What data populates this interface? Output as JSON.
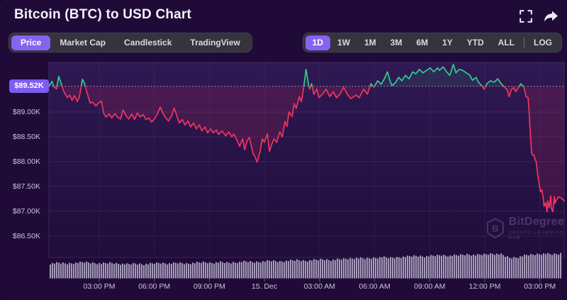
{
  "header": {
    "title": "Bitcoin (BTC) to USD Chart",
    "fullscreen_icon": "fullscreen",
    "share_icon": "share-arrow"
  },
  "toolbar": {
    "tabs": [
      {
        "label": "Price",
        "active": true
      },
      {
        "label": "Market Cap",
        "active": false
      },
      {
        "label": "Candlestick",
        "active": false
      },
      {
        "label": "TradingView",
        "active": false
      }
    ],
    "ranges": [
      {
        "label": "1D",
        "active": true
      },
      {
        "label": "1W",
        "active": false
      },
      {
        "label": "1M",
        "active": false
      },
      {
        "label": "3M",
        "active": false
      },
      {
        "label": "6M",
        "active": false
      },
      {
        "label": "1Y",
        "active": false
      },
      {
        "label": "YTD",
        "active": false
      },
      {
        "label": "ALL",
        "active": false
      }
    ],
    "log_label": "LOG"
  },
  "watermark": {
    "name": "BitDegree",
    "tagline": "CRYPTO LEARNING HUB"
  },
  "colors": {
    "background": "#200b38",
    "accent": "#8663f3",
    "badge": "#7c5cf3",
    "line_up": "#31cd8e",
    "line_down": "#f1355f",
    "volume_bar": "#b7aecb",
    "axis_text": "#c9c2da"
  },
  "chart_data": {
    "type": "line",
    "title": "Bitcoin (BTC) to USD, 1D",
    "current_price_label": "$89.52K",
    "baseline_price": 89.52,
    "ylim": [
      86.07,
      90.0
    ],
    "y_ticks": [
      {
        "price": 89.0,
        "label": "$89.00K"
      },
      {
        "price": 88.5,
        "label": "$88.50K"
      },
      {
        "price": 88.0,
        "label": "$88.00K"
      },
      {
        "price": 87.5,
        "label": "$87.50K"
      },
      {
        "price": 87.0,
        "label": "$87.00K"
      },
      {
        "price": 86.5,
        "label": "$86.50K"
      }
    ],
    "x_ticks": [
      "03:00 PM",
      "06:00 PM",
      "09:00 PM",
      "15. Dec",
      "03:00 AM",
      "06:00 AM",
      "09:00 AM",
      "12:00 PM",
      "03:00 PM"
    ],
    "legend_position": "none",
    "grid": true,
    "points": [
      [
        0,
        89.53
      ],
      [
        0.004,
        89.58
      ],
      [
        0.006,
        89.62
      ],
      [
        0.01,
        89.5
      ],
      [
        0.015,
        89.47
      ],
      [
        0.019,
        89.72
      ],
      [
        0.023,
        89.6
      ],
      [
        0.025,
        89.53
      ],
      [
        0.03,
        89.39
      ],
      [
        0.036,
        89.29
      ],
      [
        0.04,
        89.34
      ],
      [
        0.045,
        89.24
      ],
      [
        0.05,
        89.33
      ],
      [
        0.055,
        89.21
      ],
      [
        0.059,
        89.3
      ],
      [
        0.065,
        89.66
      ],
      [
        0.069,
        89.58
      ],
      [
        0.074,
        89.39
      ],
      [
        0.08,
        89.18
      ],
      [
        0.085,
        89.2
      ],
      [
        0.091,
        89.12
      ],
      [
        0.096,
        89.18
      ],
      [
        0.102,
        89.22
      ],
      [
        0.106,
        88.98
      ],
      [
        0.111,
        88.9
      ],
      [
        0.117,
        88.96
      ],
      [
        0.122,
        88.88
      ],
      [
        0.128,
        88.97
      ],
      [
        0.133,
        88.9
      ],
      [
        0.139,
        88.86
      ],
      [
        0.144,
        89.04
      ],
      [
        0.15,
        88.92
      ],
      [
        0.155,
        88.86
      ],
      [
        0.161,
        88.96
      ],
      [
        0.166,
        88.85
      ],
      [
        0.172,
        88.98
      ],
      [
        0.177,
        88.9
      ],
      [
        0.183,
        88.95
      ],
      [
        0.188,
        88.85
      ],
      [
        0.194,
        88.88
      ],
      [
        0.199,
        88.8
      ],
      [
        0.205,
        88.86
      ],
      [
        0.21,
        88.95
      ],
      [
        0.216,
        89.1
      ],
      [
        0.221,
        88.98
      ],
      [
        0.227,
        88.88
      ],
      [
        0.232,
        88.82
      ],
      [
        0.238,
        88.92
      ],
      [
        0.243,
        89.08
      ],
      [
        0.249,
        88.9
      ],
      [
        0.253,
        88.78
      ],
      [
        0.259,
        88.85
      ],
      [
        0.264,
        88.74
      ],
      [
        0.27,
        88.82
      ],
      [
        0.275,
        88.7
      ],
      [
        0.281,
        88.78
      ],
      [
        0.286,
        88.66
      ],
      [
        0.292,
        88.74
      ],
      [
        0.297,
        88.62
      ],
      [
        0.303,
        88.7
      ],
      [
        0.308,
        88.58
      ],
      [
        0.314,
        88.66
      ],
      [
        0.319,
        88.58
      ],
      [
        0.325,
        88.64
      ],
      [
        0.329,
        88.55
      ],
      [
        0.336,
        88.62
      ],
      [
        0.343,
        88.52
      ],
      [
        0.349,
        88.6
      ],
      [
        0.355,
        88.5
      ],
      [
        0.359,
        88.56
      ],
      [
        0.366,
        88.41
      ],
      [
        0.37,
        88.31
      ],
      [
        0.376,
        88.46
      ],
      [
        0.38,
        88.24
      ],
      [
        0.384,
        88.41
      ],
      [
        0.389,
        88.49
      ],
      [
        0.393,
        88.31
      ],
      [
        0.396,
        88.17
      ],
      [
        0.4,
        88.1
      ],
      [
        0.404,
        87.99
      ],
      [
        0.41,
        88.21
      ],
      [
        0.414,
        88.46
      ],
      [
        0.418,
        88.39
      ],
      [
        0.424,
        88.56
      ],
      [
        0.428,
        88.21
      ],
      [
        0.432,
        88.34
      ],
      [
        0.437,
        88.46
      ],
      [
        0.442,
        88.39
      ],
      [
        0.448,
        88.6
      ],
      [
        0.453,
        88.5
      ],
      [
        0.458,
        88.81
      ],
      [
        0.462,
        88.71
      ],
      [
        0.466,
        89.0
      ],
      [
        0.472,
        88.91
      ],
      [
        0.476,
        89.17
      ],
      [
        0.48,
        89.07
      ],
      [
        0.486,
        89.31
      ],
      [
        0.49,
        89.21
      ],
      [
        0.494,
        89.46
      ],
      [
        0.499,
        89.86
      ],
      [
        0.503,
        89.6
      ],
      [
        0.506,
        89.46
      ],
      [
        0.51,
        89.57
      ],
      [
        0.514,
        89.36
      ],
      [
        0.52,
        89.46
      ],
      [
        0.524,
        89.29
      ],
      [
        0.531,
        89.36
      ],
      [
        0.538,
        89.46
      ],
      [
        0.545,
        89.31
      ],
      [
        0.552,
        89.41
      ],
      [
        0.558,
        89.29
      ],
      [
        0.565,
        89.36
      ],
      [
        0.572,
        89.5
      ],
      [
        0.579,
        89.36
      ],
      [
        0.586,
        89.27
      ],
      [
        0.596,
        89.34
      ],
      [
        0.602,
        89.29
      ],
      [
        0.611,
        89.46
      ],
      [
        0.618,
        89.36
      ],
      [
        0.625,
        89.57
      ],
      [
        0.631,
        89.5
      ],
      [
        0.638,
        89.63
      ],
      [
        0.645,
        89.56
      ],
      [
        0.651,
        89.67
      ],
      [
        0.657,
        89.81
      ],
      [
        0.662,
        89.63
      ],
      [
        0.666,
        89.53
      ],
      [
        0.673,
        89.6
      ],
      [
        0.679,
        89.7
      ],
      [
        0.685,
        89.63
      ],
      [
        0.692,
        89.74
      ],
      [
        0.699,
        89.67
      ],
      [
        0.706,
        89.81
      ],
      [
        0.712,
        89.77
      ],
      [
        0.719,
        89.86
      ],
      [
        0.726,
        89.79
      ],
      [
        0.733,
        89.84
      ],
      [
        0.74,
        89.89
      ],
      [
        0.747,
        89.81
      ],
      [
        0.754,
        89.89
      ],
      [
        0.758,
        89.84
      ],
      [
        0.765,
        89.91
      ],
      [
        0.772,
        89.81
      ],
      [
        0.778,
        89.74
      ],
      [
        0.785,
        89.96
      ],
      [
        0.79,
        89.79
      ],
      [
        0.796,
        89.86
      ],
      [
        0.803,
        89.84
      ],
      [
        0.81,
        89.79
      ],
      [
        0.817,
        89.74
      ],
      [
        0.822,
        89.64
      ],
      [
        0.829,
        89.7
      ],
      [
        0.834,
        89.6
      ],
      [
        0.84,
        89.53
      ],
      [
        0.845,
        89.46
      ],
      [
        0.85,
        89.57
      ],
      [
        0.857,
        89.63
      ],
      [
        0.864,
        89.6
      ],
      [
        0.871,
        89.67
      ],
      [
        0.878,
        89.57
      ],
      [
        0.884,
        89.5
      ],
      [
        0.889,
        89.46
      ],
      [
        0.893,
        89.31
      ],
      [
        0.898,
        89.46
      ],
      [
        0.902,
        89.49
      ],
      [
        0.906,
        89.41
      ],
      [
        0.912,
        89.5
      ],
      [
        0.916,
        89.57
      ],
      [
        0.92,
        89.53
      ],
      [
        0.923,
        89.46
      ],
      [
        0.926,
        89.31
      ],
      [
        0.93,
        89.29
      ],
      [
        0.932,
        88.99
      ],
      [
        0.934,
        88.6
      ],
      [
        0.937,
        88.17
      ],
      [
        0.939,
        88.13
      ],
      [
        0.941,
        88.14
      ],
      [
        0.944,
        88.03
      ],
      [
        0.946,
        87.99
      ],
      [
        0.948,
        87.79
      ],
      [
        0.95,
        87.64
      ],
      [
        0.953,
        87.46
      ],
      [
        0.954,
        87.39
      ],
      [
        0.957,
        87.43
      ],
      [
        0.96,
        87.21
      ],
      [
        0.961,
        87.1
      ],
      [
        0.964,
        87.17
      ],
      [
        0.967,
        86.99
      ],
      [
        0.968,
        87.21
      ],
      [
        0.971,
        87.07
      ],
      [
        0.974,
        87.31
      ],
      [
        0.975,
        87.06
      ],
      [
        0.978,
        86.99
      ],
      [
        0.981,
        87.3
      ],
      [
        0.982,
        87.16
      ],
      [
        0.985,
        87.23
      ],
      [
        0.989,
        87.29
      ],
      [
        0.994,
        87.27
      ],
      [
        1,
        87.21
      ]
    ],
    "volume_profile": [
      21,
      22,
      21,
      22,
      23,
      22,
      21,
      22,
      21,
      20,
      21,
      20,
      21,
      22,
      21,
      22,
      21,
      22,
      23,
      22,
      23,
      22,
      23,
      24,
      23,
      24,
      25,
      24,
      25,
      26,
      25,
      26,
      27,
      26,
      27,
      28,
      29,
      28,
      29,
      30,
      29,
      30,
      31,
      32,
      31,
      32,
      33,
      32,
      33,
      34,
      33,
      34,
      35,
      34,
      29,
      30,
      33,
      34,
      35,
      34,
      35
    ]
  }
}
